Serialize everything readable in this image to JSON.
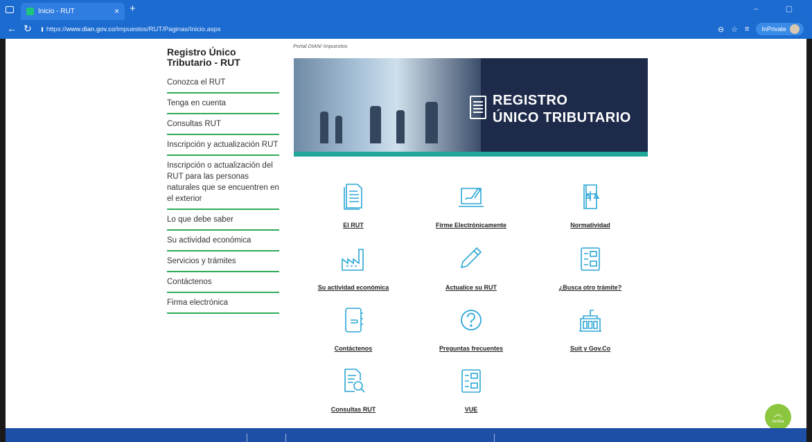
{
  "browser": {
    "tab_title": "Inicio - RUT",
    "tab_close": "×",
    "new_tab": "+",
    "url_prefix": "https://",
    "url_domain": "www.dian.gov.co",
    "url_path": "/impuestos/RUT/Paginas/Inicio.aspx",
    "inprivate_label": "InPrivate"
  },
  "breadcrumb": "Portal DIAN/  Impuestos",
  "sidebar": {
    "title": "Registro Único Tributario - RUT",
    "items": [
      {
        "label": "Conozca el RUT"
      },
      {
        "label": "Tenga en cuenta"
      },
      {
        "label": "Consultas RUT"
      },
      {
        "label": "Inscripción y actualización RUT"
      },
      {
        "label": "Inscripción o actualización del RUT para las personas naturales que se encuentren en el exterior"
      },
      {
        "label": "Lo que debe saber"
      },
      {
        "label": "Su actividad económica"
      },
      {
        "label": "Servicios y trámites"
      },
      {
        "label": "Contáctenos"
      },
      {
        "label": "Firma electrónica"
      }
    ]
  },
  "banner": {
    "line1": "REGISTRO",
    "line2": "ÚNICO TRIBUTARIO"
  },
  "cards": [
    {
      "label": "El RUT",
      "icon": "document-icon"
    },
    {
      "label": "Firme Electrónicamente",
      "icon": "laptop-signature-icon"
    },
    {
      "label": "Normatividad",
      "icon": "law-book-icon"
    },
    {
      "label": "Su actividad económica",
      "icon": "factory-icon"
    },
    {
      "label": "Actualice su RUT",
      "icon": "pencil-icon"
    },
    {
      "label": "¿Busca otro trámite?",
      "icon": "form-icon"
    },
    {
      "label": "Contáctenos",
      "icon": "notebook-icon"
    },
    {
      "label": "Preguntas frecuentes",
      "icon": "question-icon"
    },
    {
      "label": "Suit y Gov.Co",
      "icon": "building-icon"
    },
    {
      "label": "Consultas RUT",
      "icon": "document-search-icon"
    },
    {
      "label": "VUE",
      "icon": "form-icon"
    }
  ],
  "scroll_top": {
    "label": "Arriba"
  },
  "colors": {
    "accent_green": "#2eaa56",
    "icon_blue": "#2ba6d6",
    "banner_navy": "#1d2a4a",
    "teal_stripe": "#21a69a",
    "footer_blue": "#1e4fa6",
    "button_green": "#8cc63e"
  }
}
